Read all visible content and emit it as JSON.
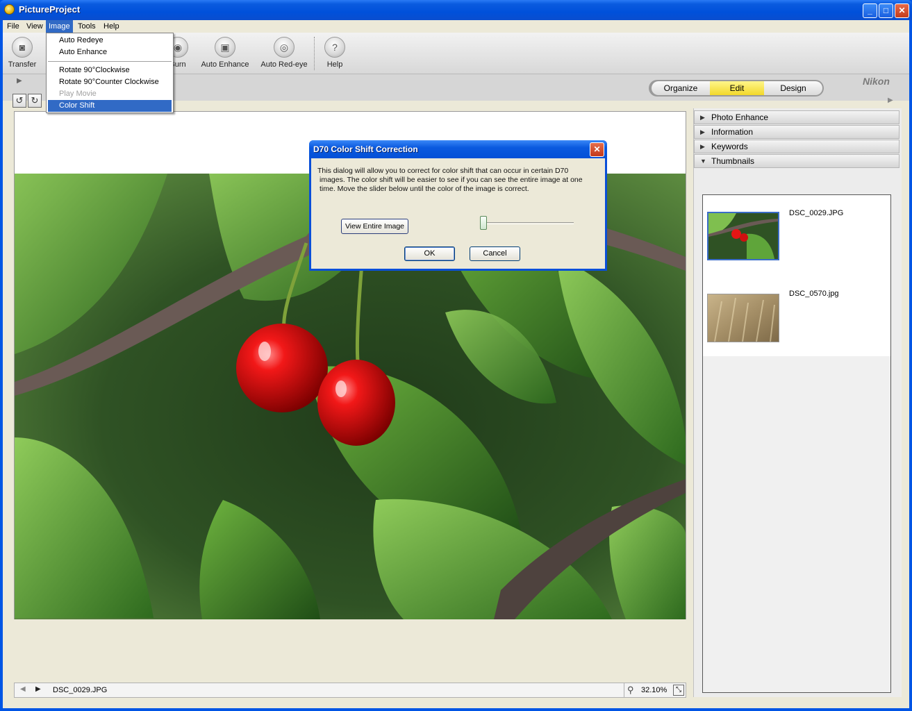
{
  "window": {
    "title": "PictureProject",
    "minimize_label": "_",
    "maximize_label": "□",
    "close_label": "✕"
  },
  "menubar": {
    "items": [
      "File",
      "View",
      "Image",
      "Tools",
      "Help"
    ],
    "active": "Image"
  },
  "toolbar": {
    "transfer_label": "Transfer",
    "burn_label": "Burn",
    "auto_enhance_label": "Auto Enhance",
    "auto_redeye_label": "Auto Red-eye",
    "help_label": "Help"
  },
  "image_menu": {
    "items": [
      {
        "label": "Auto Redeye",
        "state": "normal"
      },
      {
        "label": "Auto Enhance",
        "state": "normal"
      },
      {
        "label": "Rotate 90°Clockwise",
        "state": "normal"
      },
      {
        "label": "Rotate 90°Counter Clockwise",
        "state": "normal"
      },
      {
        "label": "Play Movie",
        "state": "disabled"
      },
      {
        "label": "Color Shift",
        "state": "selected"
      }
    ]
  },
  "mode_tabs": {
    "organize": "Organize",
    "edit": "Edit",
    "design": "Design",
    "active": "Edit"
  },
  "brand": {
    "logo_text": "Nikon"
  },
  "rotate_buttons": {
    "ccw_icon": "rotate-ccw-icon",
    "cw_icon": "rotate-cw-icon",
    "ccw_glyph": "↺",
    "cw_glyph": "↻"
  },
  "dialog": {
    "title": "D70 Color Shift Correction",
    "close_label": "✕",
    "body_line1": "This dialog will allow you to correct for color  shift that can occur in certain D70",
    "body_line2": "images. The color shift will be easier to see if you can see the entire image at one",
    "body_line3": "time. Move the slider below until the color of the image is correct.",
    "view_entire_label": "View Entire Image",
    "slider_value": 0,
    "ok_label": "OK",
    "cancel_label": "Cancel"
  },
  "right_panel": {
    "sections": [
      {
        "label": "Photo Enhance",
        "expanded": false
      },
      {
        "label": "Information",
        "expanded": false
      },
      {
        "label": "Keywords",
        "expanded": false
      },
      {
        "label": "Thumbnails",
        "expanded": true
      }
    ],
    "thumbnails": [
      {
        "name": "DSC_0029.JPG",
        "selected": true
      },
      {
        "name": "DSC_0570.jpg",
        "selected": false
      }
    ]
  },
  "statusbar": {
    "filename": "DSC_0029.JPG",
    "zoom": "32.10%"
  },
  "colors": {
    "title_blue": "#0054E3",
    "menu_highlight": "#316AC5",
    "edit_tab_yellow": "#F7E64A"
  }
}
